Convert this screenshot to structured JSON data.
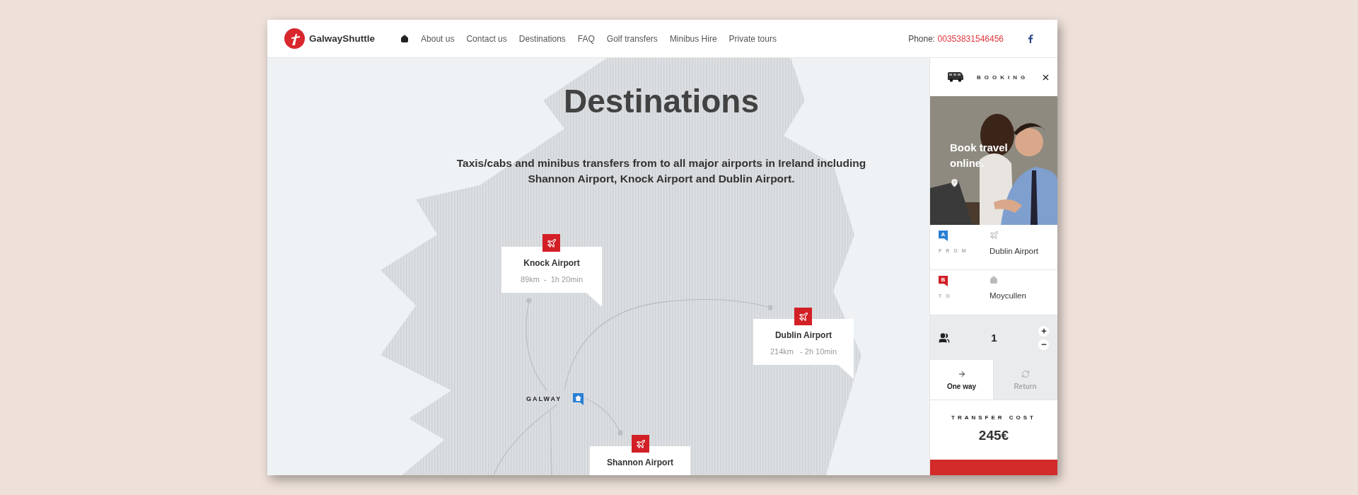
{
  "header": {
    "logo": "GalwayShuttle",
    "nav": [
      {
        "kind": "home"
      },
      {
        "kind": "link",
        "label": "About us"
      },
      {
        "kind": "link",
        "label": "Contact us"
      },
      {
        "kind": "link",
        "label": "Destinations"
      },
      {
        "kind": "link",
        "label": "FAQ"
      },
      {
        "kind": "link",
        "label": "Golf transfers"
      },
      {
        "kind": "link",
        "label": "Minibus Hire"
      },
      {
        "kind": "link",
        "label": "Private tours"
      }
    ],
    "phone_label": "Phone:",
    "phone": "00353831546456"
  },
  "page": {
    "title": "Destinations",
    "subtitle": "Taxis/cabs and minibus transfers from to all major airports in Ireland including Shannon Airport, Knock Airport and Dublin Airport."
  },
  "map": {
    "origin": "GALWAY",
    "destinations": [
      {
        "name": "Knock Airport",
        "route": "89km  -  1h 20min"
      },
      {
        "name": "Dublin Airport",
        "route": "214km   - 2h 10min"
      },
      {
        "name": "Shannon Airport"
      }
    ]
  },
  "booking": {
    "title": "BOOKING",
    "promo": "Book travel online.",
    "from": {
      "marker": "A",
      "label": "FROM",
      "value": "Dublin Airport"
    },
    "to": {
      "marker": "B",
      "label": "TO",
      "value": "Moycullen"
    },
    "passengers": "1",
    "trip_types": [
      {
        "label": "One way",
        "selected": true
      },
      {
        "label": "Return",
        "selected": false
      }
    ],
    "cost_label": "TRANSFER COST",
    "cost": "245€"
  }
}
